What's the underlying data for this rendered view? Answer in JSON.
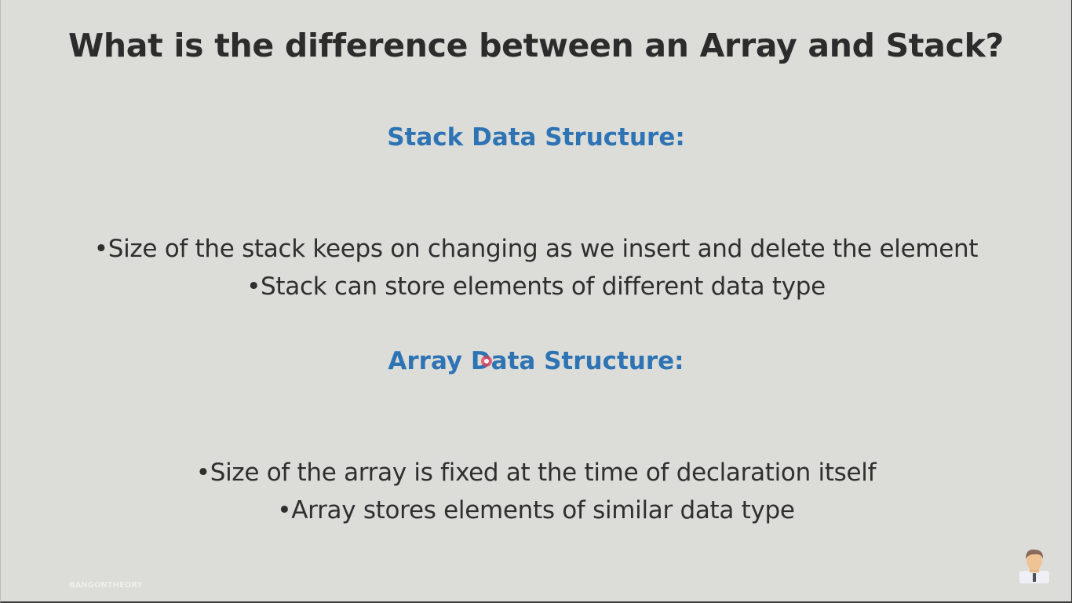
{
  "slide": {
    "title": "What is the difference between an Array and Stack?",
    "sections": [
      {
        "heading": "Stack Data Structure:",
        "bullets": [
          "•Size of the stack keeps on changing as we insert and delete the element",
          "•Stack can store elements of different data type"
        ]
      },
      {
        "heading": "Array Data Structure:",
        "bullets": [
          "•Size of the array is fixed at the time of declaration itself",
          "•Array stores elements of similar data type"
        ]
      }
    ],
    "watermark": "BANGONTHEORY"
  },
  "colors": {
    "background": "#dcddd8",
    "heading": "#2e74b5",
    "text": "#2f2f2f"
  },
  "icons": [
    "presenter-avatar-icon",
    "pointer-cursor-icon"
  ]
}
